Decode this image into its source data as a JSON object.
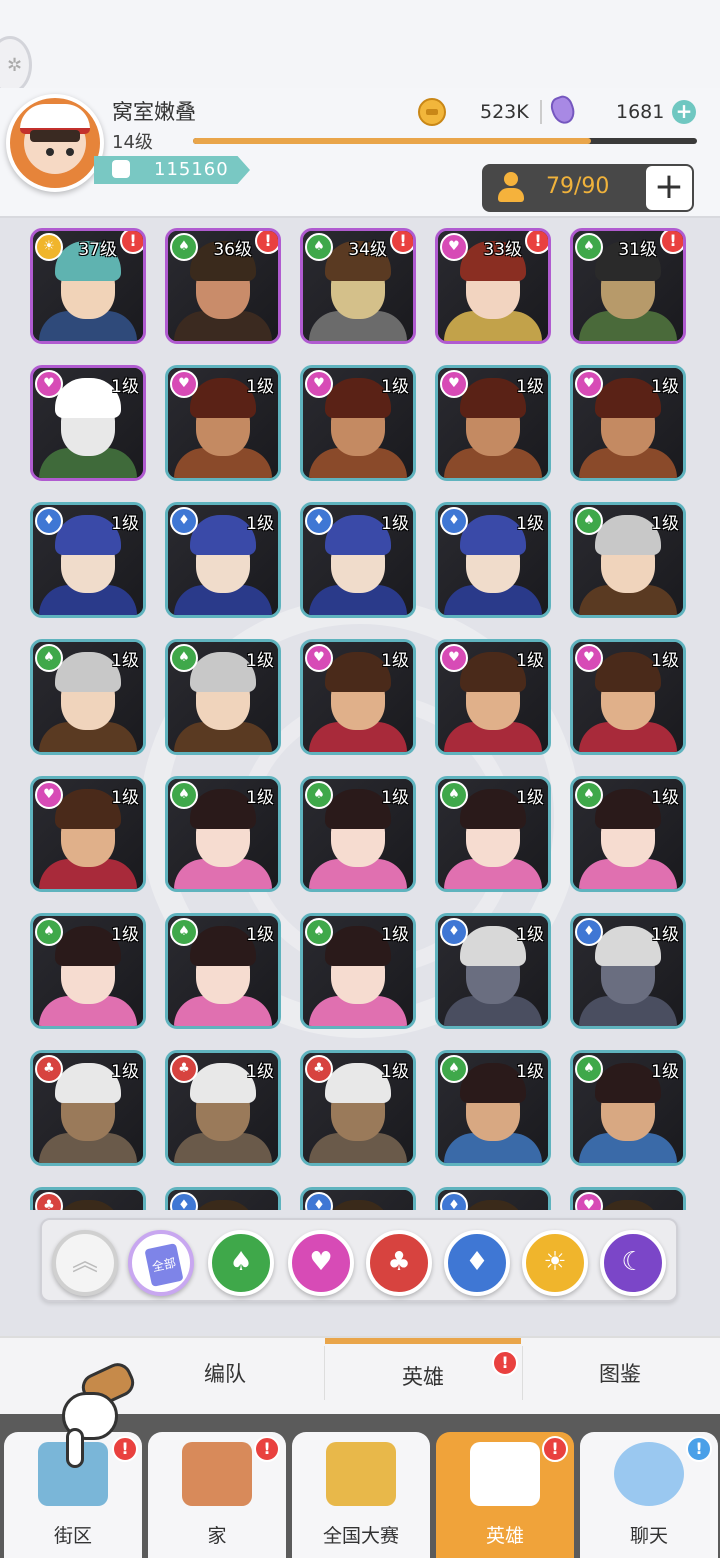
{
  "header": {
    "player_name": "窝室嫩叠",
    "player_level": "14级",
    "xp_fraction": 0.79,
    "power": "115160",
    "coins": "523K",
    "gems": "1681",
    "gem_add": "+",
    "capacity": "79/90",
    "capacity_add": "+"
  },
  "element_colors": {
    "gold": "#f0b52c",
    "green": "#3fa84a",
    "pink": "#d74bb6",
    "blue": "#3f77d4",
    "red": "#d7433f"
  },
  "heroes": [
    {
      "level": "37级",
      "element": "gold",
      "alert": "!",
      "rarity": "purple",
      "skin": "#f1d3b8",
      "hair": "#5fb3b0",
      "outfit": "#2f4a7a"
    },
    {
      "level": "36级",
      "element": "green",
      "alert": "!",
      "rarity": "purple",
      "skin": "#c98c6a",
      "hair": "#3a2a1c",
      "outfit": "#3b2a20"
    },
    {
      "level": "34级",
      "element": "green",
      "alert": "!",
      "rarity": "purple",
      "skin": "#d4c08a",
      "hair": "#5a3a22",
      "outfit": "#6b6b6b"
    },
    {
      "level": "33级",
      "element": "pink",
      "alert": "!",
      "rarity": "purple",
      "skin": "#f2d4c0",
      "hair": "#8a2e22",
      "outfit": "#c2a24a"
    },
    {
      "level": "31级",
      "element": "green",
      "alert": "!",
      "rarity": "purple",
      "skin": "#b79a6a",
      "hair": "#2a2a2a",
      "outfit": "#4a6a3a"
    },
    {
      "level": "1级",
      "element": "pink",
      "alert": "",
      "rarity": "purple",
      "skin": "#e8e8e8",
      "hair": "#ffffff",
      "outfit": "#3f6a3a"
    },
    {
      "level": "1级",
      "element": "pink",
      "alert": "",
      "rarity": "teal",
      "skin": "#c48a62",
      "hair": "#5a2216",
      "outfit": "#8a4a2a"
    },
    {
      "level": "1级",
      "element": "pink",
      "alert": "",
      "rarity": "teal",
      "skin": "#c48a62",
      "hair": "#5a2216",
      "outfit": "#8a4a2a"
    },
    {
      "level": "1级",
      "element": "pink",
      "alert": "",
      "rarity": "teal",
      "skin": "#c48a62",
      "hair": "#5a2216",
      "outfit": "#8a4a2a"
    },
    {
      "level": "1级",
      "element": "pink",
      "alert": "",
      "rarity": "teal",
      "skin": "#c48a62",
      "hair": "#5a2216",
      "outfit": "#8a4a2a"
    },
    {
      "level": "1级",
      "element": "blue",
      "alert": "",
      "rarity": "teal",
      "skin": "#f0dccb",
      "hair": "#3a4aa8",
      "outfit": "#2a3a8a"
    },
    {
      "level": "1级",
      "element": "blue",
      "alert": "",
      "rarity": "teal",
      "skin": "#f0dccb",
      "hair": "#3a4aa8",
      "outfit": "#2a3a8a"
    },
    {
      "level": "1级",
      "element": "blue",
      "alert": "",
      "rarity": "teal",
      "skin": "#f0dccb",
      "hair": "#3a4aa8",
      "outfit": "#2a3a8a"
    },
    {
      "level": "1级",
      "element": "blue",
      "alert": "",
      "rarity": "teal",
      "skin": "#f0dccb",
      "hair": "#3a4aa8",
      "outfit": "#2a3a8a"
    },
    {
      "level": "1级",
      "element": "green",
      "alert": "",
      "rarity": "teal",
      "skin": "#f0d4bc",
      "hair": "#c8c8c8",
      "outfit": "#5a3a22"
    },
    {
      "level": "1级",
      "element": "green",
      "alert": "",
      "rarity": "teal",
      "skin": "#f0d4bc",
      "hair": "#c8c8c8",
      "outfit": "#5a3a22"
    },
    {
      "level": "1级",
      "element": "green",
      "alert": "",
      "rarity": "teal",
      "skin": "#f0d4bc",
      "hair": "#c8c8c8",
      "outfit": "#5a3a22"
    },
    {
      "level": "1级",
      "element": "pink",
      "alert": "",
      "rarity": "teal",
      "skin": "#e0b08a",
      "hair": "#4a2a1a",
      "outfit": "#a82a3a"
    },
    {
      "level": "1级",
      "element": "pink",
      "alert": "",
      "rarity": "teal",
      "skin": "#e0b08a",
      "hair": "#4a2a1a",
      "outfit": "#a82a3a"
    },
    {
      "level": "1级",
      "element": "pink",
      "alert": "",
      "rarity": "teal",
      "skin": "#e0b08a",
      "hair": "#4a2a1a",
      "outfit": "#a82a3a"
    },
    {
      "level": "1级",
      "element": "pink",
      "alert": "",
      "rarity": "teal",
      "skin": "#e0b08a",
      "hair": "#4a2a1a",
      "outfit": "#a82a3a"
    },
    {
      "level": "1级",
      "element": "green",
      "alert": "",
      "rarity": "teal",
      "skin": "#f6dcd0",
      "hair": "#2a1a1a",
      "outfit": "#e070b0"
    },
    {
      "level": "1级",
      "element": "green",
      "alert": "",
      "rarity": "teal",
      "skin": "#f6dcd0",
      "hair": "#2a1a1a",
      "outfit": "#e070b0"
    },
    {
      "level": "1级",
      "element": "green",
      "alert": "",
      "rarity": "teal",
      "skin": "#f6dcd0",
      "hair": "#2a1a1a",
      "outfit": "#e070b0"
    },
    {
      "level": "1级",
      "element": "green",
      "alert": "",
      "rarity": "teal",
      "skin": "#f6dcd0",
      "hair": "#2a1a1a",
      "outfit": "#e070b0"
    },
    {
      "level": "1级",
      "element": "green",
      "alert": "",
      "rarity": "teal",
      "skin": "#f6dcd0",
      "hair": "#2a1a1a",
      "outfit": "#e070b0"
    },
    {
      "level": "1级",
      "element": "green",
      "alert": "",
      "rarity": "teal",
      "skin": "#f6dcd0",
      "hair": "#2a1a1a",
      "outfit": "#e070b0"
    },
    {
      "level": "1级",
      "element": "green",
      "alert": "",
      "rarity": "teal",
      "skin": "#f6dcd0",
      "hair": "#2a1a1a",
      "outfit": "#e070b0"
    },
    {
      "level": "1级",
      "element": "blue",
      "alert": "",
      "rarity": "teal",
      "skin": "#6a6e80",
      "hair": "#d8d8d8",
      "outfit": "#4a4e60"
    },
    {
      "level": "1级",
      "element": "blue",
      "alert": "",
      "rarity": "teal",
      "skin": "#6a6e80",
      "hair": "#d8d8d8",
      "outfit": "#4a4e60"
    },
    {
      "level": "1级",
      "element": "red",
      "alert": "",
      "rarity": "teal",
      "skin": "#9a7a5a",
      "hair": "#e8e8e8",
      "outfit": "#6a5a4a"
    },
    {
      "level": "1级",
      "element": "red",
      "alert": "",
      "rarity": "teal",
      "skin": "#9a7a5a",
      "hair": "#e8e8e8",
      "outfit": "#6a5a4a"
    },
    {
      "level": "1级",
      "element": "red",
      "alert": "",
      "rarity": "teal",
      "skin": "#9a7a5a",
      "hair": "#e8e8e8",
      "outfit": "#6a5a4a"
    },
    {
      "level": "1级",
      "element": "green",
      "alert": "",
      "rarity": "teal",
      "skin": "#d8a882",
      "hair": "#2a1a1a",
      "outfit": "#3a6aa8"
    },
    {
      "level": "1级",
      "element": "green",
      "alert": "",
      "rarity": "teal",
      "skin": "#d8a882",
      "hair": "#2a1a1a",
      "outfit": "#3a6aa8"
    },
    {
      "level": "",
      "element": "red",
      "alert": "",
      "rarity": "teal",
      "skin": "#c48a62",
      "hair": "#3a2a1a",
      "outfit": "#5a3a2a"
    },
    {
      "level": "",
      "element": "blue",
      "alert": "",
      "rarity": "teal",
      "skin": "#c48a62",
      "hair": "#3a2a1a",
      "outfit": "#5a3a2a"
    },
    {
      "level": "",
      "element": "blue",
      "alert": "",
      "rarity": "teal",
      "skin": "#c48a62",
      "hair": "#3a2a1a",
      "outfit": "#5a3a2a"
    },
    {
      "level": "",
      "element": "blue",
      "alert": "",
      "rarity": "teal",
      "skin": "#c48a62",
      "hair": "#3a2a1a",
      "outfit": "#5a3a2a"
    },
    {
      "level": "",
      "element": "pink",
      "alert": "",
      "rarity": "teal",
      "skin": "#c48a62",
      "hair": "#3a2a1a",
      "outfit": "#5a3a2a"
    }
  ],
  "filters": {
    "collapse_icon": "chevron-up-icon",
    "all_label": "全部",
    "items": [
      "spade-green",
      "heart-pink",
      "club-red",
      "diamond-blue",
      "sun-gold",
      "moon-purple"
    ]
  },
  "tabs": {
    "formation": "编队",
    "heroes": "英雄",
    "heroes_alert": "!",
    "codex": "图鉴"
  },
  "nav": {
    "street": "街区",
    "street_alert": "!",
    "home": "家",
    "home_alert": "!",
    "tournament": "全国大赛",
    "heroes": "英雄",
    "heroes_alert": "!",
    "chat": "聊天",
    "chat_alert": "!"
  }
}
